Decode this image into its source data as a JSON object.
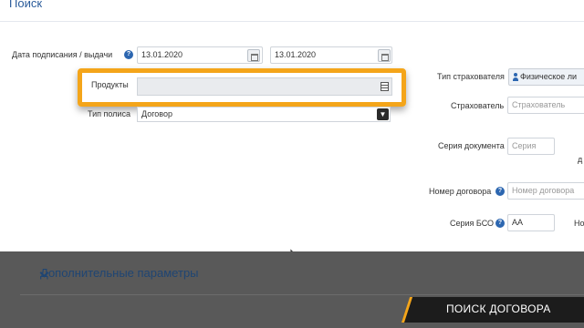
{
  "header": {
    "title": "Поиск"
  },
  "form": {
    "date_label": "Дата подписания / выдачи",
    "date_from": "13.01.2020",
    "date_to": "13.01.2020",
    "products_label": "Продукты",
    "products_value": "",
    "policy_type_label": "Тип полиса",
    "policy_type_value": "Договор",
    "insurer_type_label": "Тип страхователя",
    "insurer_type_value": "Физическое ли",
    "insurer_label": "Страхователь",
    "insurer_placeholder": "Страхователь",
    "doc_series_label": "Серия документа",
    "doc_series_placeholder": "Серия",
    "doc_cut_label": "д",
    "contract_number_label": "Номер договора",
    "contract_number_placeholder": "Номер договора",
    "bso_series_label": "Серия БСО",
    "bso_series_value": "АА",
    "bso_cut_label": "Но"
  },
  "section": {
    "additional_params": "Дополнительные параметры"
  },
  "banner": {
    "text": "ПОИСК ДОГОВОРА"
  },
  "colors": {
    "accent": "#f4a51a",
    "primary": "#2c66b0",
    "band": "#595959"
  }
}
